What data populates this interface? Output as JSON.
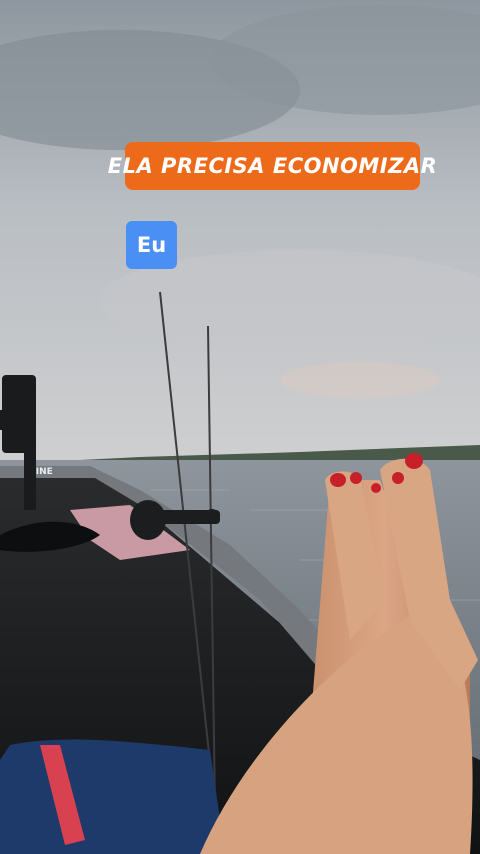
{
  "overlay": {
    "caption_text": "ELA PRECISA ECONOMIZAR",
    "tag_text": "Eu"
  },
  "photo": {
    "boat_text": "LINE"
  },
  "colors": {
    "caption_bg": "#ee6a1b",
    "tag_bg": "#4a8ff4",
    "nail_polish": "#c8202a"
  }
}
